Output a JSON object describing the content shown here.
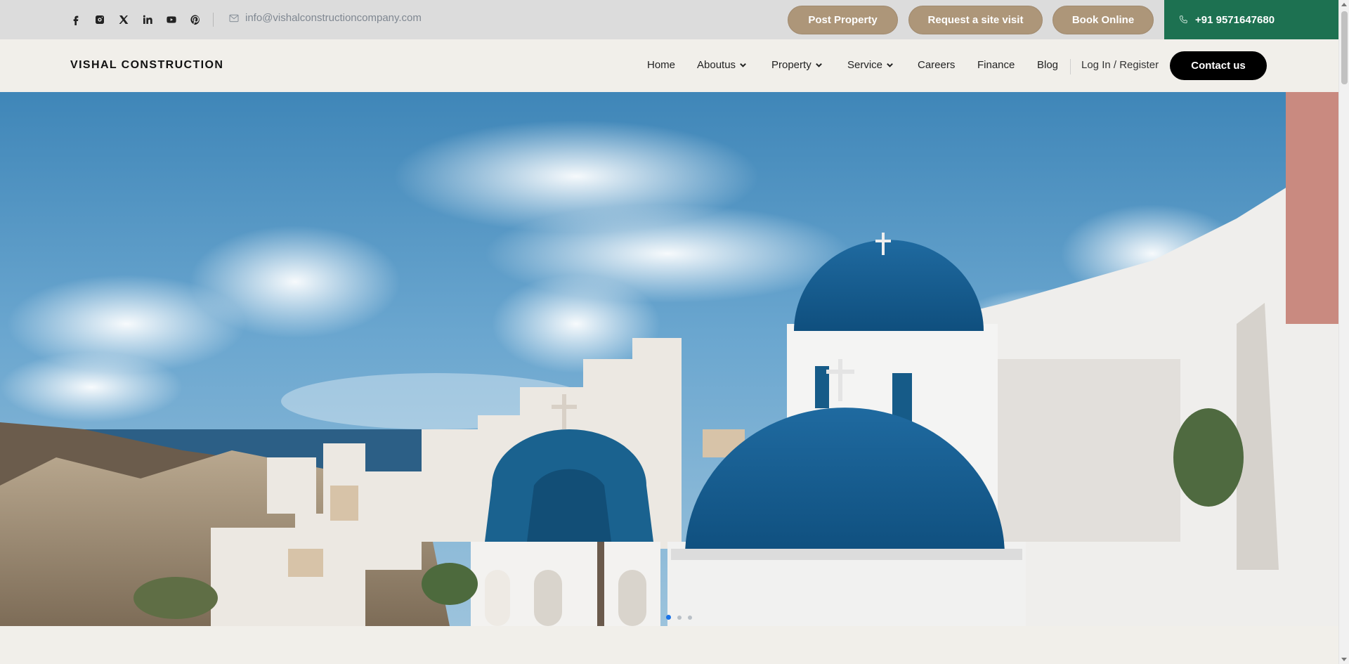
{
  "topbar": {
    "socials": [
      "facebook-icon",
      "instagram-icon",
      "x-icon",
      "linkedin-icon",
      "youtube-icon",
      "pinterest-icon"
    ],
    "email": "info@vishalconstructioncompany.com",
    "buttons": {
      "post_property": "Post Property",
      "request_visit": "Request a site visit",
      "book_online": "Book Online"
    },
    "phone": "+91 9571647680"
  },
  "navbar": {
    "brand": "VISHAL CONSTRUCTION",
    "items": [
      {
        "label": "Home"
      },
      {
        "label": "Aboutus"
      },
      {
        "label": "Property"
      },
      {
        "label": "Service"
      },
      {
        "label": "Careers"
      },
      {
        "label": "Finance"
      },
      {
        "label": "Blog"
      }
    ],
    "login": "Log In / Register",
    "contact": "Contact us"
  },
  "hero": {
    "slides": 3,
    "active_slide": 1
  },
  "colors": {
    "accent_tan": "#ad9679",
    "phone_green": "#1d7151",
    "contact_black": "#000000",
    "active_dot": "#1a73e8"
  }
}
